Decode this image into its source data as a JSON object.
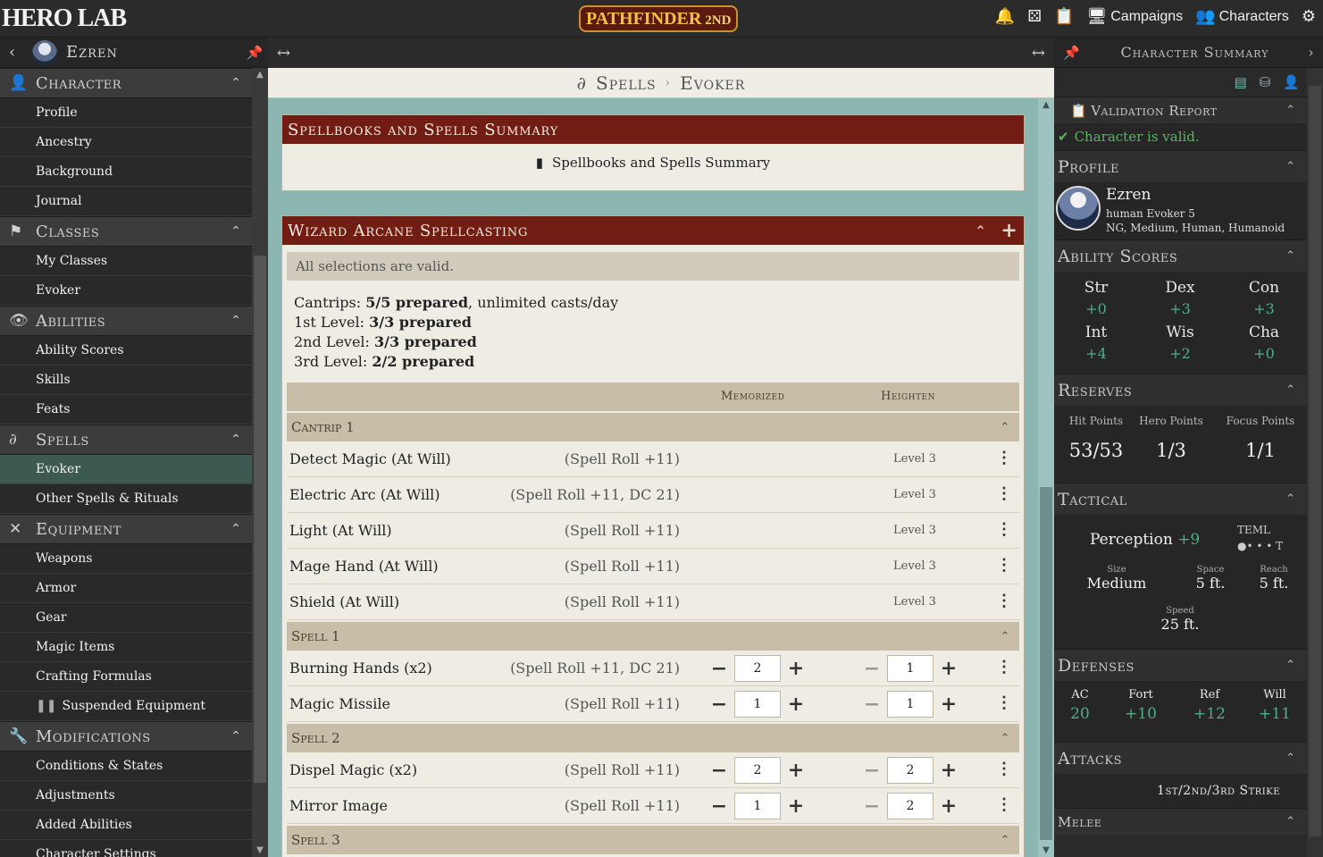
{
  "app": {
    "name": "HERO LAB",
    "game": "PATHFINDER",
    "edition": "2ND"
  },
  "top": {
    "campaigns": "Campaigns",
    "characters": "Characters"
  },
  "character": {
    "name": "Ezren"
  },
  "sidebar": {
    "sections": [
      {
        "label": "Character",
        "icon": "person-icon",
        "items": [
          "Profile",
          "Ancestry",
          "Background",
          "Journal"
        ]
      },
      {
        "label": "Classes",
        "icon": "flag-icon",
        "items": [
          "My Classes",
          "Evoker"
        ]
      },
      {
        "label": "Abilities",
        "icon": "eye-icon",
        "items": [
          "Ability Scores",
          "Skills",
          "Feats"
        ]
      },
      {
        "label": "Spells",
        "icon": "spell-icon",
        "items": [
          "Evoker",
          "Other Spells & Rituals"
        ]
      },
      {
        "label": "Equipment",
        "icon": "crossed-swords-icon",
        "items": [
          "Weapons",
          "Armor",
          "Gear",
          "Magic Items",
          "Crafting Formulas",
          "Suspended Equipment"
        ]
      },
      {
        "label": "Modifications",
        "icon": "wrench-icon",
        "items": [
          "Conditions & States",
          "Adjustments",
          "Added Abilities",
          "Character Settings"
        ]
      }
    ]
  },
  "breadcrumb": {
    "section": "Spells",
    "page": "Evoker"
  },
  "summary_panel": {
    "title": "Spellbooks and Spells Summary",
    "button": "Spellbooks and Spells Summary"
  },
  "casting": {
    "title": "Wizard Arcane Spellcasting",
    "valid": "All selections are valid.",
    "counts": [
      {
        "label": "Cantrips: ",
        "value": "5/5 prepared",
        "suffix": ", unlimited casts/day"
      },
      {
        "label": "1st Level: ",
        "value": "3/3 prepared",
        "suffix": ""
      },
      {
        "label": "2nd Level: ",
        "value": "3/3 prepared",
        "suffix": ""
      },
      {
        "label": "3rd Level: ",
        "value": "2/2 prepared",
        "suffix": ""
      }
    ],
    "col_memorized": "Memorized",
    "col_heighten": "Heighten",
    "groups": [
      {
        "label": "Cantrip 1",
        "spells": [
          {
            "name": "Detect Magic (At Will)",
            "roll": "(Spell Roll +11)",
            "level": "Level 3"
          },
          {
            "name": "Electric Arc (At Will)",
            "roll": "(Spell Roll +11, DC 21)",
            "level": "Level 3"
          },
          {
            "name": "Light (At Will)",
            "roll": "(Spell Roll +11)",
            "level": "Level 3"
          },
          {
            "name": "Mage Hand (At Will)",
            "roll": "(Spell Roll +11)",
            "level": "Level 3"
          },
          {
            "name": "Shield (At Will)",
            "roll": "(Spell Roll +11)",
            "level": "Level 3"
          }
        ]
      },
      {
        "label": "Spell 1",
        "spells": [
          {
            "name": "Burning Hands (x2)",
            "roll": "(Spell Roll +11, DC 21)",
            "memorized": "2",
            "heighten": "1"
          },
          {
            "name": "Magic Missile",
            "roll": "(Spell Roll +11)",
            "memorized": "1",
            "heighten": "1"
          }
        ]
      },
      {
        "label": "Spell 2",
        "spells": [
          {
            "name": "Dispel Magic (x2)",
            "roll": "(Spell Roll +11)",
            "memorized": "2",
            "heighten": "2"
          },
          {
            "name": "Mirror Image",
            "roll": "(Spell Roll +11)",
            "memorized": "1",
            "heighten": "2"
          }
        ]
      },
      {
        "label": "Spell 3",
        "spells": []
      }
    ]
  },
  "right": {
    "title": "Character Summary",
    "validation": {
      "title": "Validation Report",
      "status": "Character is valid."
    },
    "profile": {
      "title": "Profile",
      "name": "Ezren",
      "line1": "human Evoker 5",
      "line2": "NG, Medium, Human, Humanoid"
    },
    "abilities": {
      "title": "Ability Scores",
      "scores": [
        {
          "name": "Str",
          "mod": "+0"
        },
        {
          "name": "Dex",
          "mod": "+3"
        },
        {
          "name": "Con",
          "mod": "+3"
        },
        {
          "name": "Int",
          "mod": "+4"
        },
        {
          "name": "Wis",
          "mod": "+2"
        },
        {
          "name": "Cha",
          "mod": "+0"
        }
      ]
    },
    "reserves": {
      "title": "Reserves",
      "items": [
        {
          "label": "Hit Points",
          "value": "53/53"
        },
        {
          "label": "Hero Points",
          "value": "1/3"
        },
        {
          "label": "Focus Points",
          "value": "1/1"
        }
      ]
    },
    "tactical": {
      "title": "Tactical",
      "perception_label": "Perception",
      "perception_value": "+9",
      "teml": "TEML",
      "teml_dots": "●• • •  T",
      "size_label": "Size",
      "size_value": "Medium",
      "space_label": "Space",
      "space_value": "5 ft.",
      "reach_label": "Reach",
      "reach_value": "5 ft.",
      "speed_label": "Speed",
      "speed_value": "25 ft."
    },
    "defenses": {
      "title": "Defenses",
      "items": [
        {
          "label": "AC",
          "value": "20"
        },
        {
          "label": "Fort",
          "value": "+10"
        },
        {
          "label": "Ref",
          "value": "+12"
        },
        {
          "label": "Will",
          "value": "+11"
        }
      ]
    },
    "attacks": {
      "title": "Attacks",
      "strike": "1st/2nd/3rd Strike",
      "melee": "Melee"
    }
  },
  "colors": {
    "accent_red": "#711d14",
    "teal_bg": "#8bb6b2",
    "green_mod": "#4fae86",
    "active_item": "#3c5a52"
  }
}
